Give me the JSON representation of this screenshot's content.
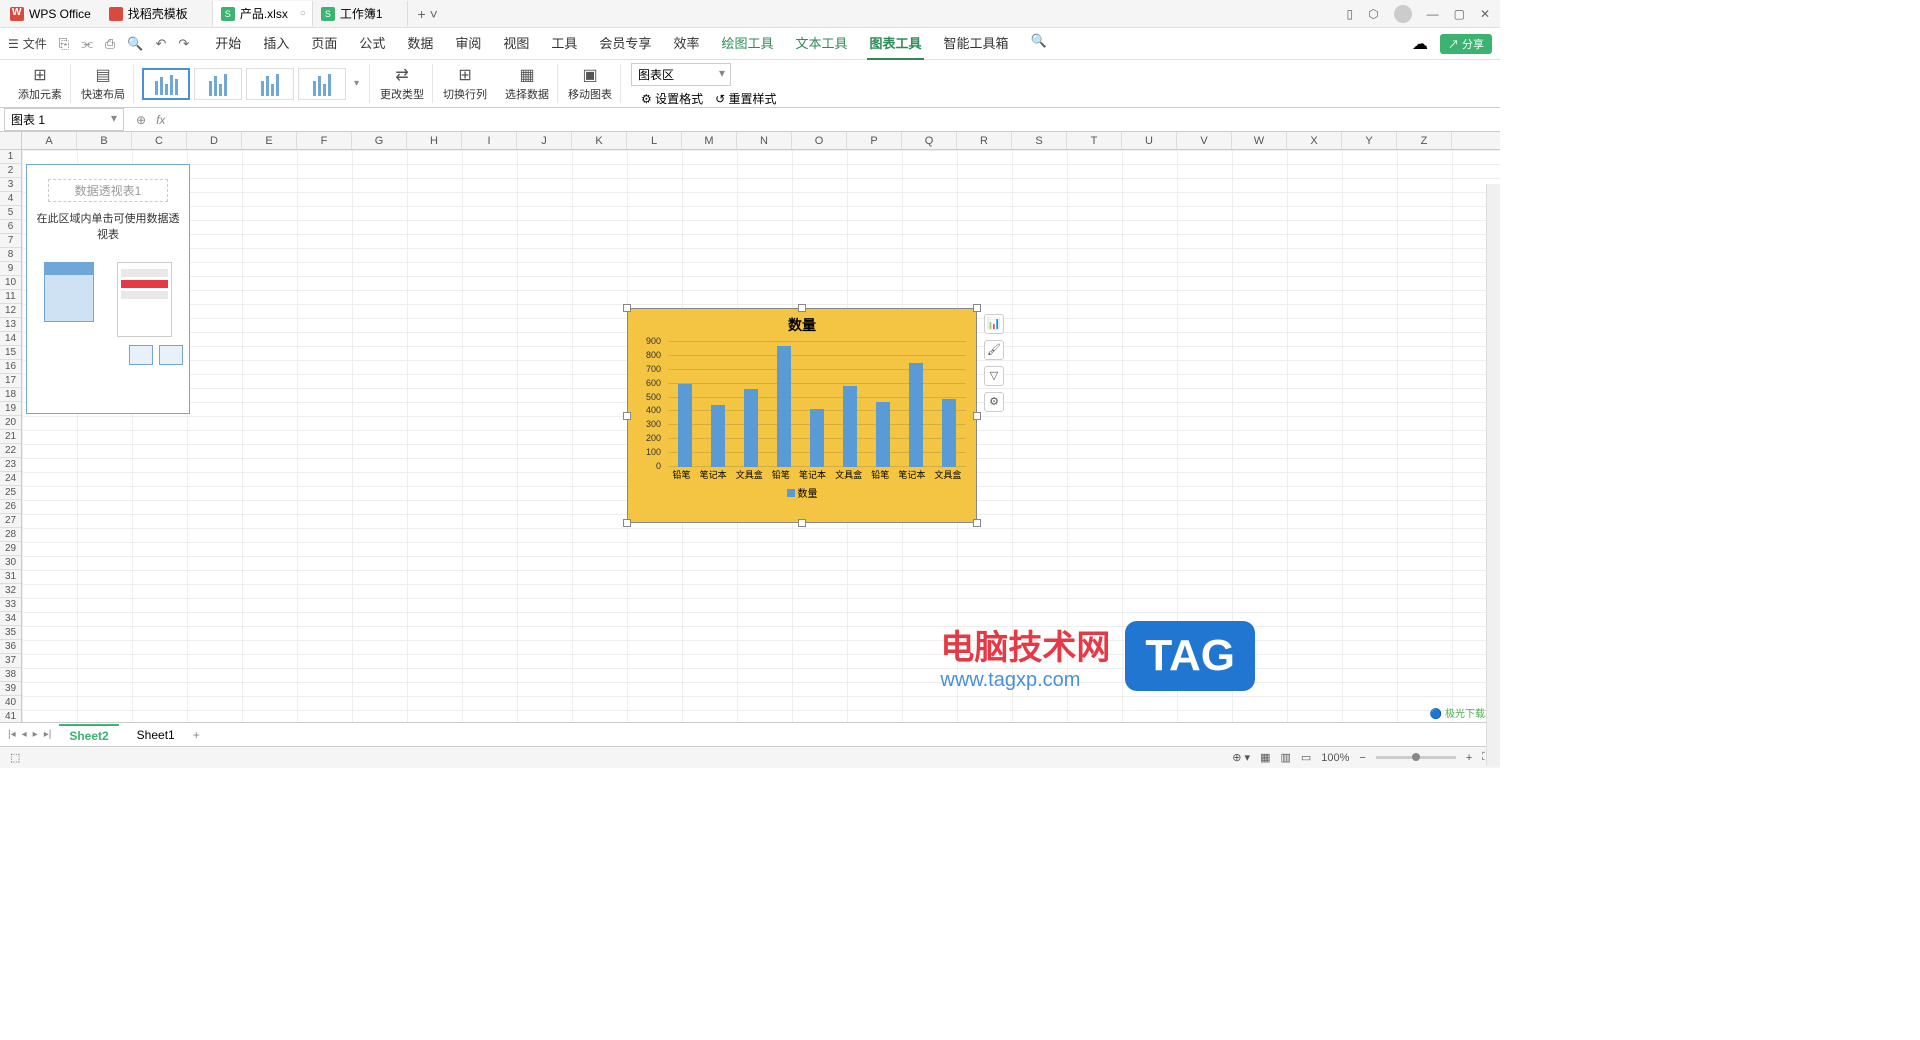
{
  "title_bar": {
    "app_name": "WPS Office",
    "tabs": [
      {
        "label": "找稻壳模板",
        "icon": "d"
      },
      {
        "label": "产品.xlsx",
        "icon": "s",
        "active": true
      },
      {
        "label": "工作簿1",
        "icon": "s"
      }
    ]
  },
  "menu": {
    "file": "文件",
    "tabs": [
      "开始",
      "插入",
      "页面",
      "公式",
      "数据",
      "审阅",
      "视图",
      "工具",
      "会员专享",
      "效率"
    ],
    "tool_tabs": [
      "绘图工具",
      "文本工具",
      "图表工具",
      "智能工具箱"
    ],
    "active_tab": "图表工具",
    "share": "分享"
  },
  "ribbon": {
    "add_element": "添加元素",
    "quick_layout": "快速布局",
    "change_type": "更改类型",
    "switch_rc": "切换行列",
    "select_data": "选择数据",
    "move_chart": "移动图表",
    "chart_area": "图表区",
    "set_format": "设置格式",
    "reset_style": "重置样式"
  },
  "name_box": "图表 1",
  "pivot": {
    "title": "数据透视表1",
    "text": "在此区域内单击可使用数据透视表"
  },
  "chart_data": {
    "type": "bar",
    "title": "数量",
    "categories": [
      "铅笔",
      "笔记本",
      "文具盒",
      "铅笔",
      "笔记本",
      "文具盒",
      "铅笔",
      "笔记本",
      "文具盒"
    ],
    "values": [
      600,
      450,
      560,
      870,
      420,
      580,
      470,
      750,
      490
    ],
    "ylabel": "",
    "xlabel": "",
    "ylim": [
      0,
      900
    ],
    "y_ticks": [
      0,
      100,
      200,
      300,
      400,
      500,
      600,
      700,
      800,
      900
    ],
    "legend": "数量",
    "series_color": "#5b9bd5",
    "bg_color": "#f4c542"
  },
  "watermark": {
    "text": "电脑技术网",
    "url": "www.tagxp.com",
    "tag": "TAG",
    "corner": "极光下载站"
  },
  "sheets": {
    "tabs": [
      "Sheet2",
      "Sheet1"
    ],
    "active": "Sheet2"
  },
  "status": {
    "zoom": "100%"
  },
  "columns": [
    "A",
    "B",
    "C",
    "D",
    "E",
    "F",
    "G",
    "H",
    "I",
    "J",
    "K",
    "L",
    "M",
    "N",
    "O",
    "P",
    "Q",
    "R",
    "S",
    "T",
    "U",
    "V",
    "W",
    "X",
    "Y",
    "Z"
  ]
}
